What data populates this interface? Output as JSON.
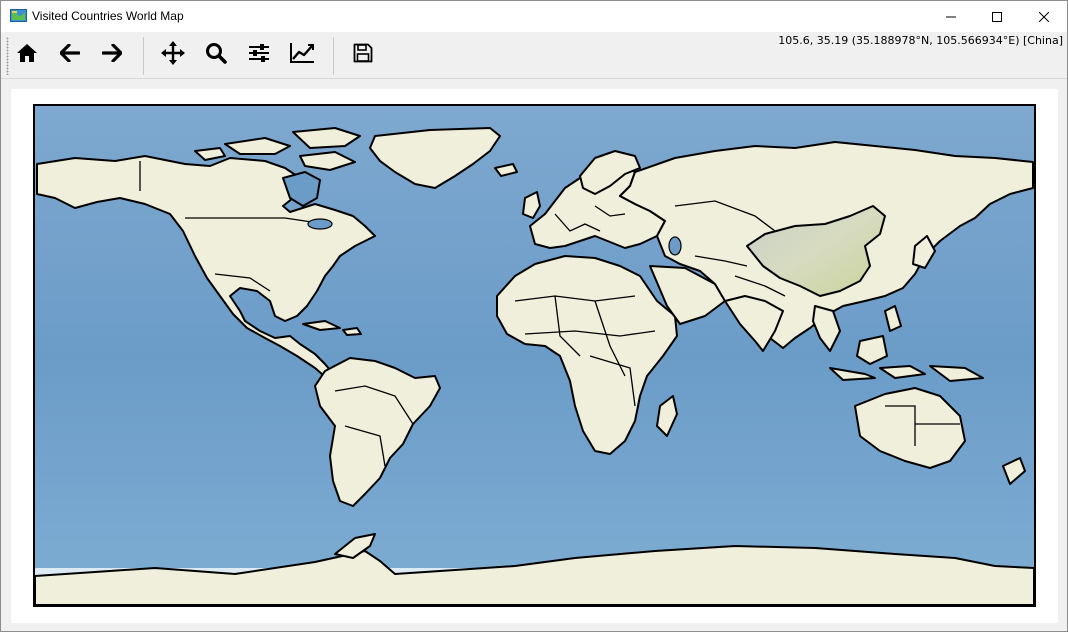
{
  "window": {
    "title": "Visited Countries World Map",
    "controls": {
      "minimize": "minimize-icon",
      "maximize": "maximize-icon",
      "close": "close-icon"
    }
  },
  "toolbar": {
    "buttons": [
      {
        "name": "home",
        "icon": "home-icon"
      },
      {
        "name": "back",
        "icon": "arrow-left-icon"
      },
      {
        "name": "forward",
        "icon": "arrow-right-icon"
      },
      {
        "name": "pan",
        "icon": "move-icon"
      },
      {
        "name": "zoom",
        "icon": "search-icon"
      },
      {
        "name": "configure-subplots",
        "icon": "sliders-icon"
      },
      {
        "name": "edit-axis",
        "icon": "line-chart-icon"
      },
      {
        "name": "save",
        "icon": "floppy-disk-icon"
      }
    ],
    "coordinate_readout": "105.6, 35.19 (35.188978°N, 105.566934°E) [China]"
  },
  "map": {
    "ocean_color": "#6f9dc6",
    "land_color": "#efefdc",
    "highlighted_country": "China",
    "border_color": "#000000"
  }
}
